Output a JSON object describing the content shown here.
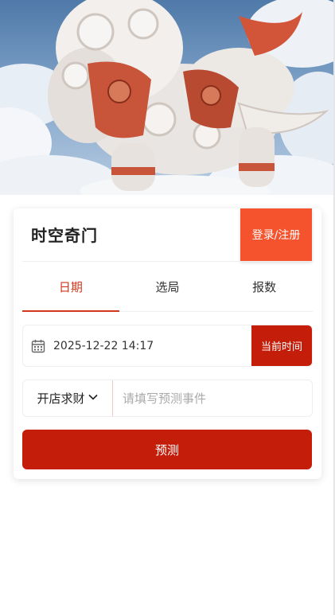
{
  "hero": {
    "image_desc": "white-and-red mythical lion statue against blue cloudy sky"
  },
  "header": {
    "title": "时空奇门",
    "login_label": "登录/注册"
  },
  "tabs": [
    {
      "label": "日期",
      "active": true
    },
    {
      "label": "选局",
      "active": false
    },
    {
      "label": "报数",
      "active": false
    }
  ],
  "date": {
    "value": "2025-12-22 14:17",
    "now_label": "当前时间",
    "icon": "calendar-icon"
  },
  "event": {
    "category": "开店求财",
    "placeholder": "请填写预测事件",
    "value": ""
  },
  "actions": {
    "predict_label": "预测"
  },
  "colors": {
    "accent": "#c41e0a",
    "login": "#f5532d",
    "active_tab": "#d0371c"
  }
}
